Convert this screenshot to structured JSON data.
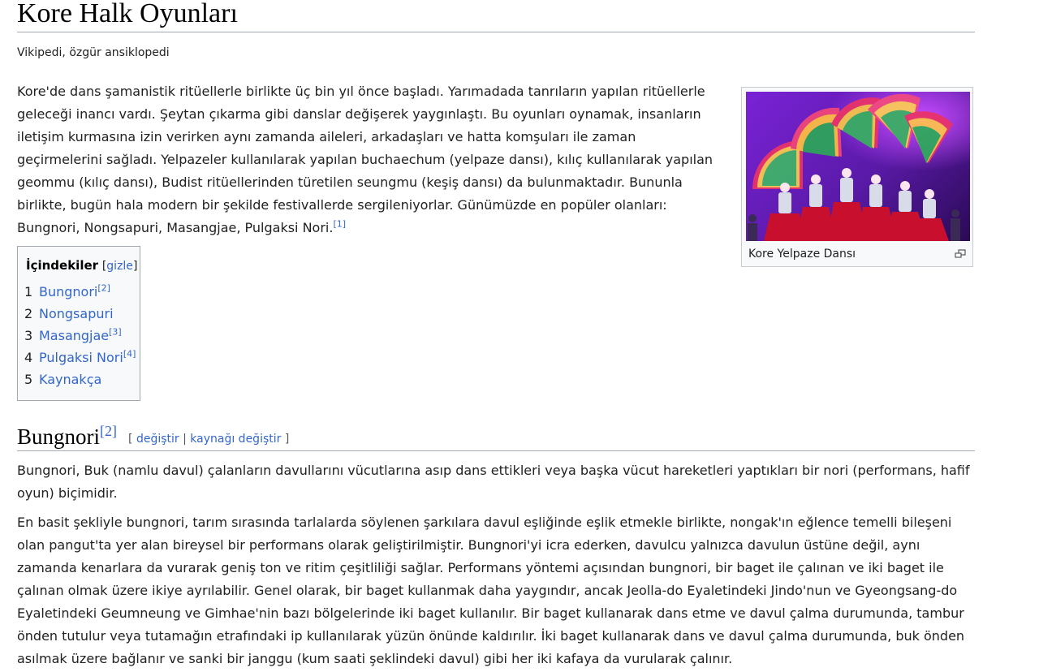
{
  "article": {
    "title": "Kore Halk Oyunları",
    "tagline": "Vikipedi, özgür ansiklopedi",
    "lead_text": "Kore'de dans şamanistik ritüellerle birlikte üç bin yıl önce başladı. Yarımadada tanrıların yapılan ritüellerle geleceği inancı vardı. Şeytan çıkarma gibi danslar değişerek yaygınlaştı. Bu oyunları oynamak, insanların iletişim kurmasına izin verirken aynı zamanda aileleri, arkadaşları ve hatta komşuları ile zaman geçirmelerini sağladı. Yelpazeler kullanılarak yapılan buchaechum (yelpaze dansı), kılıç kullanılarak yapılan geommu (kılıç dansı), Budist ritüellerinden türetilen seungmu (keşiş dansı) da bulunmaktadır. Bununla birlikte, bugün hala modern bir şekilde festivallerde sergileniyorlar. Günümüzde en popüler olanları: Bungnori, Nongsapuri, Masangjae, Pulgaksi Nori.",
    "lead_ref": "[1]"
  },
  "thumbnail": {
    "caption": "Kore Yelpaze Dansı",
    "icon": "magnify-icon"
  },
  "toc": {
    "heading": "İçindekiler",
    "toggle": "gizle",
    "items": [
      {
        "num": "1",
        "label": "Bungnori",
        "ref": "[2]"
      },
      {
        "num": "2",
        "label": "Nongsapuri",
        "ref": ""
      },
      {
        "num": "3",
        "label": "Masangjae",
        "ref": "[3]"
      },
      {
        "num": "4",
        "label": "Pulgaksi Nori",
        "ref": "[4]"
      },
      {
        "num": "5",
        "label": "Kaynakça",
        "ref": ""
      }
    ]
  },
  "section": {
    "heading": "Bungnori",
    "ref": "[2]",
    "edit_label": "değiştir",
    "edit_source_label": "kaynağı değiştir",
    "paragraph1": "Bungnori, Buk (namlu davul) çalanların davullarını vücutlarına asıp dans ettikleri veya başka vücut hareketleri yaptıkları bir nori (performans, hafif oyun) biçimidir.",
    "paragraph2": "En basit şekliyle bungnori, tarım sırasında tarlalarda söylenen şarkılara davul eşliğinde eşlik etmekle birlikte, nongak'ın eğlence temelli bileşeni olan pangut'ta yer alan bireysel bir performans olarak geliştirilmiştir. Bungnori'yi icra ederken, davulcu yalnızca davulun üstüne değil, aynı zamanda kenarlara da vurarak geniş ton ve ritim çeşitliliği sağlar. Performans yöntemi açısından bungnori, bir baget ile çalınan ve iki baget ile çalınan olmak üzere ikiye ayrılabilir. Genel olarak, bir baget kullanmak daha yaygındır, ancak Jeolla-do Eyaletindeki Jindo'nun ve Gyeongsang-do Eyaletindeki Geumneung ve Gimhae'nin bazı bölgelerinde iki baget kullanılır. Bir baget kullanarak dans etme ve davul çalma durumunda, tambur önden tutulur veya tutamağın etrafındaki ip kullanılarak yüzün önünde kaldırılır. İki baget kullanarak dans ve davul çalma durumunda, buk önden asılmak üzere bağlanır ve sanki bir janggu (kum saati şeklindeki davul) gibi her iki kafaya da vurularak çalınır."
  }
}
